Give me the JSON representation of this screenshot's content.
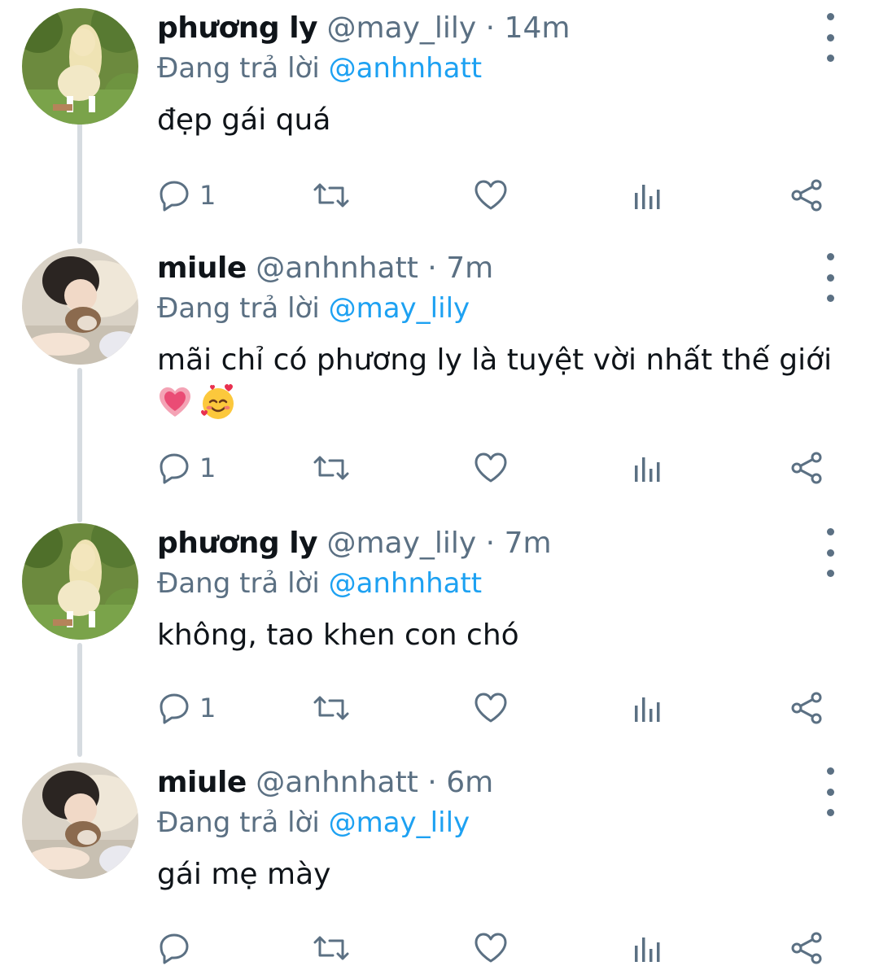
{
  "tweets": [
    {
      "name": "phương ly",
      "handle": "@may_lily",
      "separator": "·",
      "time": "14m",
      "replying_prefix": "Đang trả lời",
      "replying_to": "@anhnhatt",
      "text": "đẹp gái quá",
      "reply_count": "1",
      "avatar": "avatar-girl-garden",
      "emojis": []
    },
    {
      "name": "miule",
      "handle": "@anhnhatt",
      "separator": "·",
      "time": "7m",
      "replying_prefix": "Đang trả lời",
      "replying_to": "@may_lily",
      "text": "mãi chỉ có phương ly là tuyệt vời nhất thế giới",
      "reply_count": "1",
      "avatar": "avatar-girl-with-puppy",
      "emojis": [
        "pink-heart-emoji",
        "smiling-face-with-hearts-emoji"
      ]
    },
    {
      "name": "phương ly",
      "handle": "@may_lily",
      "separator": "·",
      "time": "7m",
      "replying_prefix": "Đang trả lời",
      "replying_to": "@anhnhatt",
      "text": "không, tao khen con chó",
      "reply_count": "1",
      "avatar": "avatar-girl-garden",
      "emojis": []
    },
    {
      "name": "miule",
      "handle": "@anhnhatt",
      "separator": "·",
      "time": "6m",
      "replying_prefix": "Đang trả lời",
      "replying_to": "@may_lily",
      "text": "gái mẹ mày",
      "reply_count": "",
      "avatar": "avatar-girl-with-puppy",
      "emojis": []
    }
  ],
  "icons": {
    "reply": "reply-icon",
    "retweet": "retweet-icon",
    "like": "like-icon",
    "analytics": "analytics-icon",
    "share": "share-icon",
    "more": "more-options-icon"
  },
  "colors": {
    "mention": "#1da1f2",
    "secondary_text": "#5b7083",
    "primary_text": "#0f1419",
    "thread_line": "#d6dbe0"
  }
}
